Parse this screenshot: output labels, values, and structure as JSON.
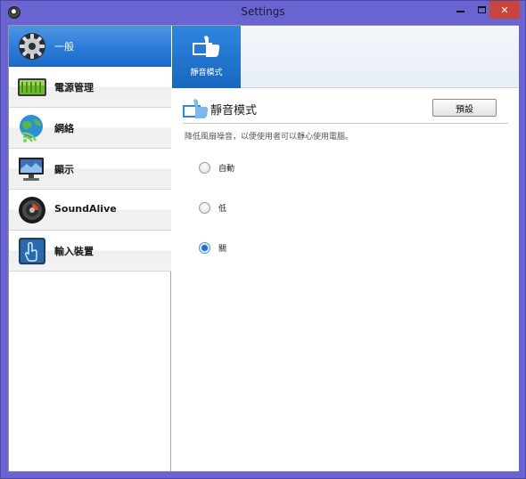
{
  "window": {
    "title": "Settings",
    "minimize_glyph": "",
    "maximize_glyph": "",
    "close_glyph": "✕",
    "icon": "app-speaker-icon"
  },
  "sidebar": {
    "items": [
      {
        "label": "一般",
        "icon": "gear-icon",
        "selected": true
      },
      {
        "label": "電源管理",
        "icon": "battery-icon",
        "selected": false
      },
      {
        "label": "網絡",
        "icon": "globe-wifi-icon",
        "selected": false
      },
      {
        "label": "顯示",
        "icon": "display-icon",
        "selected": false
      },
      {
        "label": "SoundAlive",
        "icon": "speaker-icon",
        "selected": false
      },
      {
        "label": "輸入裝置",
        "icon": "touch-icon",
        "selected": false
      }
    ]
  },
  "main": {
    "tabs": [
      {
        "label": "靜音模式",
        "icon": "silent-fan-icon",
        "selected": true
      }
    ],
    "section_title": "靜音模式",
    "default_button": "預設",
    "description": "降低風扇噪音，以便使用者可以靜心使用電腦。",
    "options": [
      {
        "label": "自動",
        "checked": false
      },
      {
        "label": "低",
        "checked": false
      },
      {
        "label": "關",
        "checked": true
      }
    ]
  },
  "colors": {
    "titlebar": "#6a63d2",
    "selected": "#2a79d6",
    "close": "#c9453c"
  }
}
